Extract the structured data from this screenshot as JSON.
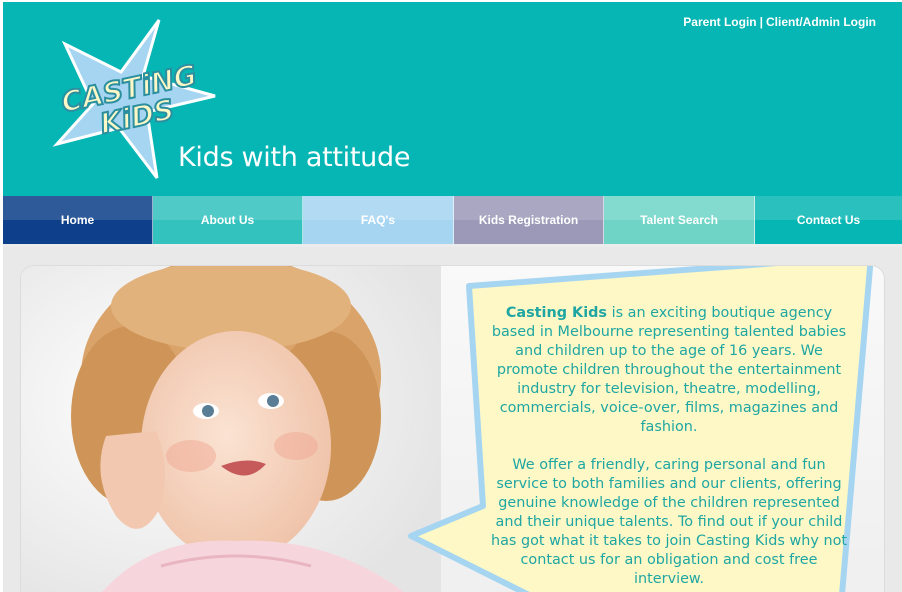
{
  "header": {
    "logo_text_line1": "CASTiNG",
    "logo_text_line2": "KiDS",
    "tagline": "Kids with attitude",
    "parent_login": "Parent Login",
    "separator": "|",
    "client_login": "Client/Admin Login"
  },
  "nav": {
    "items": [
      {
        "label": "Home",
        "color": "#0d3f8a"
      },
      {
        "label": "About Us",
        "color": "#34c2be"
      },
      {
        "label": "FAQ's",
        "color": "#a6d5f1"
      },
      {
        "label": "Kids Registration",
        "color": "#9c99b8"
      },
      {
        "label": "Talent Search",
        "color": "#6fd4c6"
      },
      {
        "label": "Contact Us",
        "color": "#06b6b4"
      }
    ]
  },
  "intro": {
    "brand": "Casting Kids",
    "para1_rest": " is an exciting boutique agency based in Melbourne representing talented babies and children up to the age of 16 years. We promote children throughout the entertainment industry for television, theatre, modelling, commercials, voice-over, films, magazines and fashion.",
    "para2": "We offer a friendly, caring personal and fun service to both families and our clients, offering genuine knowledge of the children represented and their unique talents. To find out if your child has got what it takes to join Casting Kids why not contact us for an obligation and cost free interview."
  },
  "colors": {
    "header_bg": "#06b6b4",
    "bubble_fill": "#fdf8c6",
    "bubble_border": "#a6d5f1",
    "text_teal": "#1fa6a3",
    "logo_star": "#a6d5f1",
    "logo_text": "#fdf8c6"
  }
}
